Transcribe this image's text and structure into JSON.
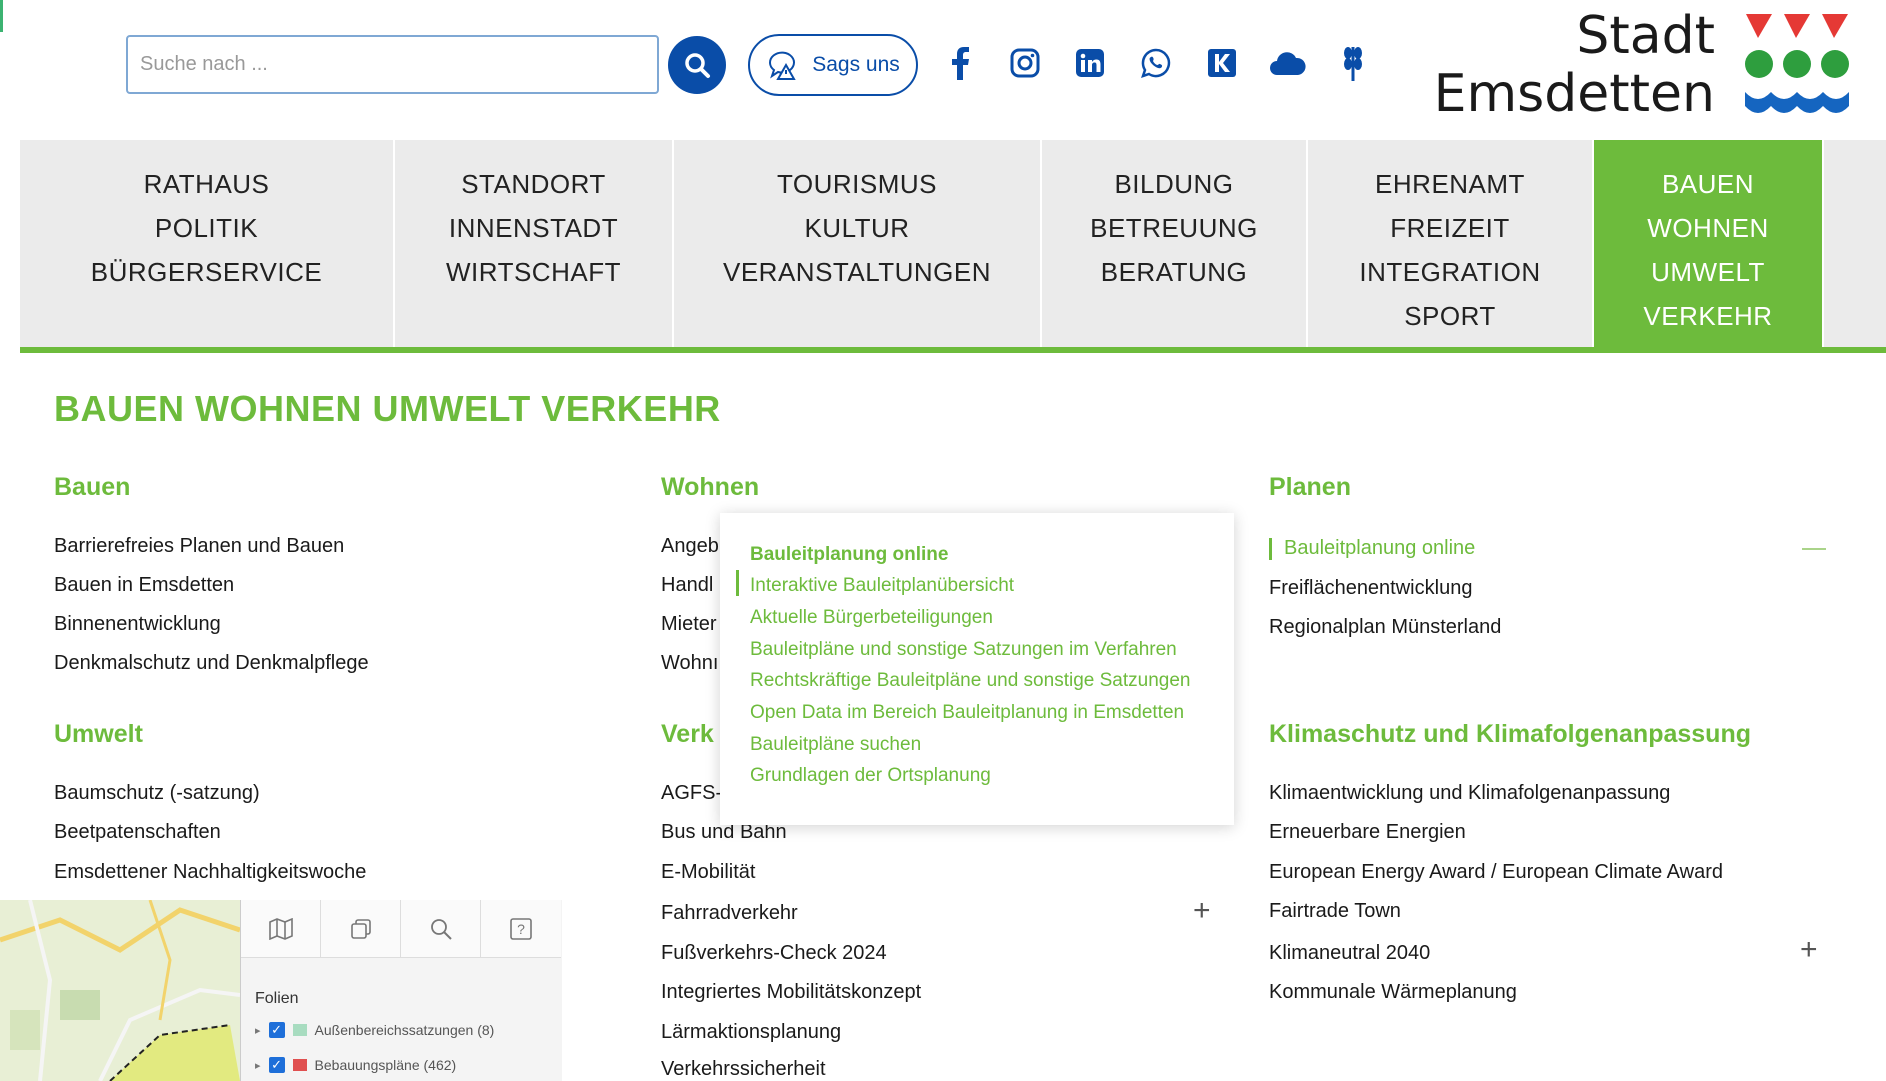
{
  "header": {
    "search_placeholder": "Suche nach ...",
    "sags_uns_label": "Sags uns",
    "social_icons": [
      "facebook-icon",
      "instagram-icon",
      "linkedin-icon",
      "whatsapp-icon",
      "k-app-icon",
      "cloud-icon",
      "wheat-icon"
    ],
    "logo": {
      "line1": "Stadt",
      "line2": "Emsdetten"
    }
  },
  "nav": [
    {
      "lines": [
        "RATHAUS",
        "POLITIK",
        "BÜRGERSERVICE"
      ],
      "active": false
    },
    {
      "lines": [
        "STANDORT",
        "INNENSTADT",
        "WIRTSCHAFT"
      ],
      "active": false
    },
    {
      "lines": [
        "TOURISMUS",
        "KULTUR",
        "VERANSTALTUNGEN"
      ],
      "active": false
    },
    {
      "lines": [
        "BILDUNG",
        "BETREUUNG",
        "BERATUNG"
      ],
      "active": false
    },
    {
      "lines": [
        "EHRENAMT",
        "FREIZEIT",
        "INTEGRATION",
        "SPORT"
      ],
      "active": false
    },
    {
      "lines": [
        "BAUEN",
        "WOHNEN",
        "UMWELT",
        "VERKEHR"
      ],
      "active": true
    }
  ],
  "page_title": "BAUEN WOHNEN UMWELT VERKEHR",
  "sections": {
    "bauen": {
      "title": "Bauen",
      "links": [
        "Barrierefreies Planen und Bauen",
        "Bauen in Emsdetten",
        "Binnenentwicklung",
        "Denkmalschutz und Denkmalpflege"
      ]
    },
    "umwelt": {
      "title": "Umwelt",
      "links": [
        "Baumschutz (-satzung)",
        "Beetpatenschaften",
        "Emsdettener Nachhaltigkeitswoche"
      ]
    },
    "wohnen": {
      "title": "Wohnen",
      "links": [
        "Angeb",
        "Handl",
        "Mieter",
        "Wohnı"
      ]
    },
    "verkehr": {
      "title": "Verk",
      "links": [
        "AGFS-",
        "Bus und Bahn",
        "E-Mobilität",
        "Fahrradverkehr",
        "Fußverkehrs-Check 2024",
        "Integriertes Mobilitätskonzept",
        "Lärmaktionsplanung",
        "Verkehrssicherheit"
      ]
    },
    "planen": {
      "title": "Planen",
      "links": [
        "Bauleitplanung online",
        "Freiflächenentwicklung",
        "Regionalplan Münsterland"
      ]
    },
    "klima": {
      "title": "Klimaschutz und Klimafolgenanpassung",
      "links": [
        "Klimaentwicklung und Klimafolgenanpassung",
        "Erneuerbare Energien",
        "European Energy Award / European Climate Award",
        "Fairtrade Town",
        "Klimaneutral 2040",
        "Kommunale Wärmeplanung"
      ]
    }
  },
  "popup": {
    "title": "Bauleitplanung online",
    "links": [
      "Interaktive Bauleitplanübersicht",
      "Aktuelle Bürgerbeteiligungen",
      "Bauleitpläne und sonstige Satzungen im Verfahren",
      "Rechtskräftige Bauleitpläne und sonstige Satzungen",
      "Open Data im Bereich Bauleitplanung in Emsdetten",
      "Bauleitpläne suchen",
      "Grundlagen der Ortsplanung"
    ]
  },
  "map": {
    "folien_label": "Folien",
    "layers": [
      {
        "label": "Außenbereichssatzungen (8)",
        "color": "#a8dcc0",
        "checked": true
      },
      {
        "label": "Bebauungspläne (462)",
        "color": "#e05050",
        "checked": true
      }
    ]
  },
  "colors": {
    "accent_green": "#6dbb3c",
    "brand_blue": "#0a4da8",
    "logo_red": "#e53935",
    "logo_green": "#2e9e3e",
    "logo_blue": "#1565c0"
  }
}
